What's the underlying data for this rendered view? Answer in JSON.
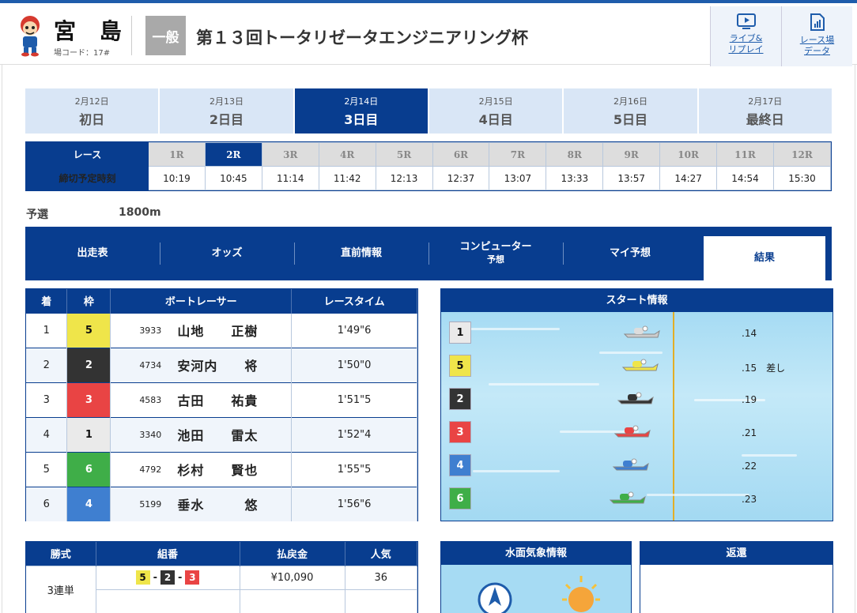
{
  "header": {
    "venue_name": "宮 島",
    "venue_code": "場コード：17#",
    "grade": "一般",
    "race_title": "第１３回トータリゼータエンジニアリング杯",
    "live_label_1": "ライブ&",
    "live_label_2": "リプレイ",
    "data_label_1": "レース場",
    "data_label_2": "データ"
  },
  "days": [
    {
      "date": "2月12日",
      "name": "初日"
    },
    {
      "date": "2月13日",
      "name": "2日目"
    },
    {
      "date": "2月14日",
      "name": "3日目"
    },
    {
      "date": "2月15日",
      "name": "4日目"
    },
    {
      "date": "2月16日",
      "name": "5日目"
    },
    {
      "date": "2月17日",
      "name": "最終日"
    }
  ],
  "active_day": "2月14日",
  "race_grid": {
    "race_label": "レース",
    "deadline_label": "締切予定時刻",
    "races": [
      "1R",
      "2R",
      "3R",
      "4R",
      "5R",
      "6R",
      "7R",
      "8R",
      "9R",
      "10R",
      "11R",
      "12R"
    ],
    "times": [
      "10:19",
      "10:45",
      "11:14",
      "11:42",
      "12:13",
      "12:37",
      "13:07",
      "13:33",
      "13:57",
      "14:27",
      "14:54",
      "15:30"
    ],
    "selected": "2R"
  },
  "race_info": {
    "type": "予選",
    "distance": "1800m"
  },
  "tabs": [
    {
      "label": "出走表"
    },
    {
      "label": "オッズ"
    },
    {
      "label": "直前情報"
    },
    {
      "label": "コンピューター",
      "sub": "予想"
    },
    {
      "label": "マイ予想"
    },
    {
      "label": "結果"
    }
  ],
  "active_tab": "結果",
  "results": {
    "headers": [
      "着",
      "枠",
      "ボートレーサー",
      "レースタイム"
    ],
    "rows": [
      {
        "place": "1",
        "frame": "5",
        "id": "3933",
        "name": "山地　　正樹",
        "time": "1'49\"6"
      },
      {
        "place": "2",
        "frame": "2",
        "id": "4734",
        "name": "安河内　　将",
        "time": "1'50\"0"
      },
      {
        "place": "3",
        "frame": "3",
        "id": "4583",
        "name": "古田　　祐貴",
        "time": "1'51\"5"
      },
      {
        "place": "4",
        "frame": "1",
        "id": "3340",
        "name": "池田　　雷太",
        "time": "1'52\"4"
      },
      {
        "place": "5",
        "frame": "6",
        "id": "4792",
        "name": "杉村　　賢也",
        "time": "1'55\"5"
      },
      {
        "place": "6",
        "frame": "4",
        "id": "5199",
        "name": "垂水　　　悠",
        "time": "1'56\"6"
      }
    ]
  },
  "start_info": {
    "title": "スタート情報",
    "rows": [
      {
        "course": "1",
        "st": ".14"
      },
      {
        "course": "5",
        "st": ".15　差し"
      },
      {
        "course": "2",
        "st": ".19"
      },
      {
        "course": "3",
        "st": ".21"
      },
      {
        "course": "4",
        "st": ".22"
      },
      {
        "course": "6",
        "st": ".23"
      }
    ]
  },
  "payout": {
    "headers": [
      "勝式",
      "組番",
      "払戻金",
      "人気"
    ],
    "bet_type": "3連単",
    "combo": [
      "5",
      "2",
      "3"
    ],
    "amount": "¥10,090",
    "popularity": "36"
  },
  "weather": {
    "title": "水面気象情報"
  },
  "refund": {
    "title": "返還"
  },
  "colors": {
    "navy": "#083d8f",
    "frame1": "#eaeaea",
    "frame2": "#333333",
    "frame3": "#e94444",
    "frame4": "#3f7fd0",
    "frame5": "#efe54a",
    "frame6": "#3fae48"
  },
  "icons": [
    "mascot-logo",
    "live-replay-icon",
    "stadium-data-icon",
    "boat-icon",
    "wind-direction-icon",
    "sun-icon"
  ]
}
